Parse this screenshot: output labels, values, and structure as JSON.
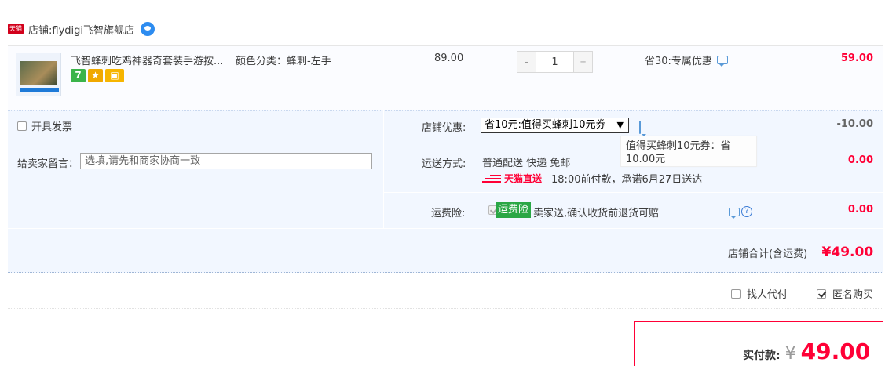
{
  "shop": {
    "badge": "天猫",
    "label": "店铺: ",
    "name": "flydigi飞智旗舰店"
  },
  "item": {
    "title": "飞智蜂刺吃鸡神器奇套装手游按...",
    "sku": "颜色分类：蜂刺-左手",
    "badges": [
      "7",
      "",
      ""
    ],
    "price": "89.00",
    "qty_minus": "-",
    "qty_value": "1",
    "qty_plus": "+",
    "discount": "省30:专属优惠",
    "subtotal": "59.00"
  },
  "options": {
    "invoice_label": "开具发票",
    "note_label": "给卖家留言：",
    "note_placeholder": "选填,请先和商家协商一致",
    "shop_discount_label": "店铺优惠:",
    "shop_discount_selected": "省10元:值得买蜂刺10元券",
    "shop_discount_value": "-10.00",
    "tooltip": "值得买蜂刺10元券：省10.00元",
    "shipping_label": "运送方式:",
    "shipping_method": "普通配送 快递 免邮",
    "shipping_value": "0.00",
    "tmall_direct": "天猫直送",
    "delivery_promise": "18:00前付款，承诺6月27日送达",
    "insurance_label": "运费险:",
    "insurance_tag": "运费险",
    "insurance_desc": "卖家送,确认收货前退货可赔",
    "insurance_value": "0.00",
    "help_q": "?"
  },
  "total": {
    "label": "店铺合计(含运费)",
    "value": "¥49.00"
  },
  "extras": {
    "agent_pay": "找人代付",
    "anonymous": "匿名购买"
  },
  "payment": {
    "label": "实付款:",
    "yen": "¥",
    "amount": "49.00"
  },
  "colors": {
    "accent": "#ff0036",
    "panel": "#f2f7ff",
    "insurance": "#2aa745"
  }
}
